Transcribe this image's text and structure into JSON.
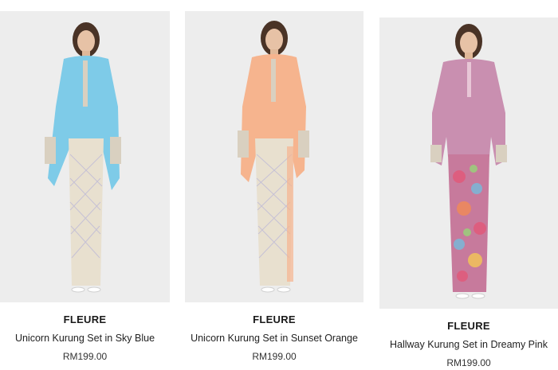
{
  "products": [
    {
      "brand": "FLEURE",
      "name": "Unicorn Kurung Set in Sky Blue",
      "price": "RM199.00",
      "top_color": "#7ecbe8",
      "skirt_color": "#e8e0cf"
    },
    {
      "brand": "FLEURE",
      "name": "Unicorn Kurung Set in Sunset Orange",
      "price": "RM199.00",
      "top_color": "#f6b48e",
      "skirt_color": "#e8e0cf"
    },
    {
      "brand": "FLEURE",
      "name": "Hallway Kurung Set in Dreamy Pink",
      "price": "RM199.00",
      "top_color": "#c98fb0",
      "skirt_color": "#c77a9c"
    }
  ]
}
